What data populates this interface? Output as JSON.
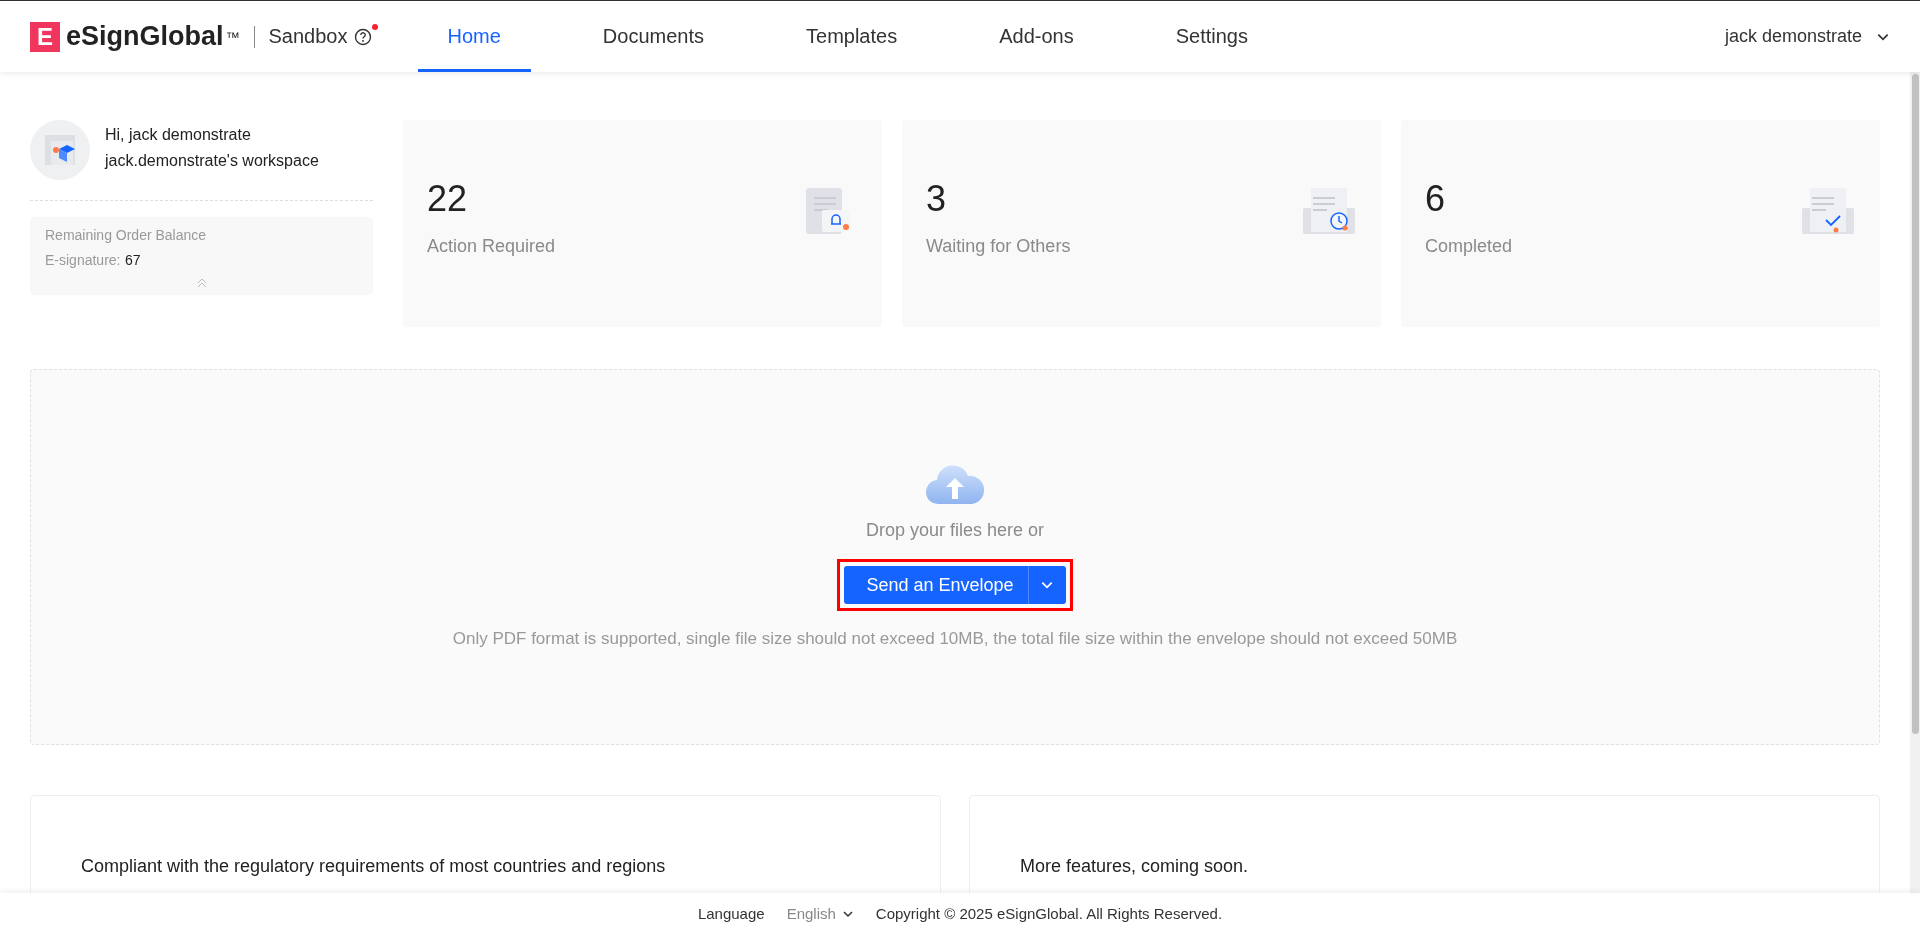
{
  "header": {
    "logo_mark": "E",
    "brand": "eSignGlobal",
    "trademark": "™",
    "environment": "Sandbox",
    "help_icon_badge": true,
    "nav": [
      {
        "label": "Home",
        "selected": true
      },
      {
        "label": "Documents",
        "selected": false
      },
      {
        "label": "Templates",
        "selected": false
      },
      {
        "label": "Add-ons",
        "selected": false
      },
      {
        "label": "Settings",
        "selected": false
      }
    ],
    "user": "jack demonstrate"
  },
  "profile": {
    "greeting": "Hi, jack demonstrate",
    "workspace": "jack.demonstrate's workspace",
    "balance_title": "Remaining Order Balance",
    "balance_label": "E-signature:",
    "balance_value": "67"
  },
  "stats": [
    {
      "kind": "action",
      "count": "22",
      "label": "Action Required"
    },
    {
      "kind": "waiting",
      "count": "3",
      "label": "Waiting for Others"
    },
    {
      "kind": "completed",
      "count": "6",
      "label": "Completed"
    }
  ],
  "upload": {
    "prompt": "Drop your files here or",
    "button": "Send an Envelope",
    "highlighted": true,
    "note": "Only PDF format is supported, single file size should not exceed 10MB, the total file size within the envelope should not exceed 50MB"
  },
  "info_cards": [
    "Compliant with the regulatory requirements of most countries and regions",
    "More features, coming soon."
  ],
  "footer": {
    "language_label": "Language",
    "language": "English",
    "copyright": "Copyright © 2025 eSignGlobal. All Rights Reserved."
  }
}
